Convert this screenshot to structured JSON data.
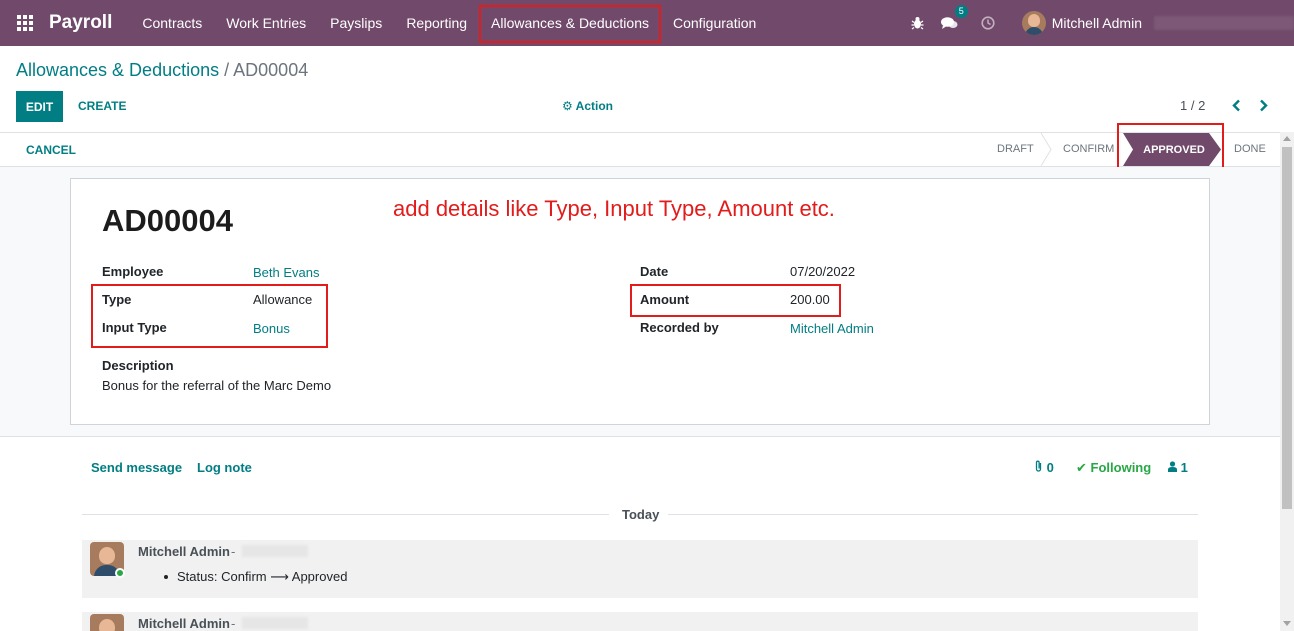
{
  "navbar": {
    "app_name": "Payroll",
    "menu": [
      "Contracts",
      "Work Entries",
      "Payslips",
      "Reporting",
      "Allowances & Deductions",
      "Configuration"
    ],
    "messages_badge": "5",
    "user_name": "Mitchell Admin",
    "icons": [
      "apps-grid-icon",
      "bug-icon",
      "chat-bubbles-icon",
      "clock-icon"
    ]
  },
  "breadcrumb": {
    "parent": "Allowances & Deductions",
    "separator": "/",
    "current": "AD00004"
  },
  "control_panel": {
    "edit_label": "EDIT",
    "create_label": "CREATE",
    "action_label": "Action",
    "pager": "1 / 2"
  },
  "statusbar": {
    "cancel_label": "CANCEL",
    "stages": [
      "DRAFT",
      "CONFIRM",
      "APPROVED",
      "DONE"
    ],
    "active_stage": "APPROVED"
  },
  "form": {
    "reference": "AD00004",
    "annotation": "add details like Type, Input Type, Amount etc.",
    "employee_label": "Employee",
    "employee_value": "Beth Evans",
    "type_label": "Type",
    "type_value": "Allowance",
    "input_type_label": "Input Type",
    "input_type_value": "Bonus",
    "description_label": "Description",
    "description_value": "Bonus for the referral of the Marc Demo",
    "date_label": "Date",
    "date_value": "07/20/2022",
    "amount_label": "Amount",
    "amount_value": "200.00",
    "recorded_by_label": "Recorded by",
    "recorded_by_value": "Mitchell Admin"
  },
  "chatter": {
    "send_message": "Send message",
    "log_note": "Log note",
    "attachments_count": "0",
    "following_label": "Following",
    "followers_count": "1",
    "date_separator": "Today",
    "messages": [
      {
        "author": "Mitchell Admin",
        "dash": "-",
        "status_from": "Confirm",
        "status_to": "Approved",
        "status_prefix": "Status:"
      },
      {
        "author": "Mitchell Admin",
        "dash": "-"
      }
    ]
  },
  "colors": {
    "navbar": "#71496a",
    "primary": "#017e84",
    "highlight": "#e21b1b",
    "active_stage": "#71496a"
  }
}
